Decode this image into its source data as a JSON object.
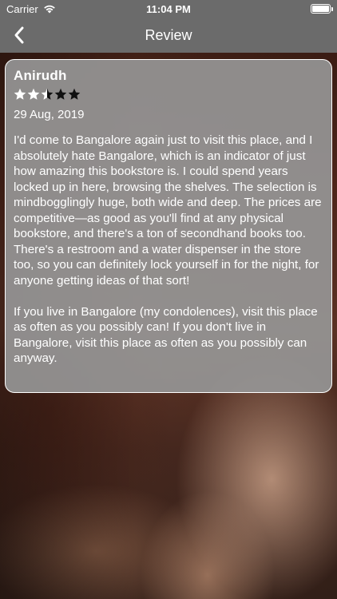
{
  "status_bar": {
    "carrier": "Carrier",
    "time": "11:04 PM"
  },
  "nav": {
    "title": "Review",
    "back_icon": "chevron-left-icon"
  },
  "review": {
    "author": "Anirudh",
    "rating": 2.5,
    "rating_max": 5,
    "date": "29 Aug, 2019",
    "paragraphs": [
      "I'd come to Bangalore again just to visit this place, and I absolutely hate Bangalore, which is an indicator of just how amazing this bookstore is. I could spend years locked up in here, browsing the shelves. The selection is mindbogglingly huge, both wide and deep. The prices are competitive—as good as you'll find at any physical bookstore, and there's a ton of secondhand books too. There's a restroom and a water dispenser in the store too, so you can definitely lock yourself in for the night, for anyone getting ideas of that sort!",
      "If you live in Bangalore (my condolences), visit this place as often as you possibly can! If you don't live in Bangalore, visit this place as often as you possibly can anyway."
    ]
  },
  "colors": {
    "bar": "#6b6b6b",
    "card": "#969696",
    "star_filled": "#ffffff",
    "star_empty": "#111111"
  }
}
